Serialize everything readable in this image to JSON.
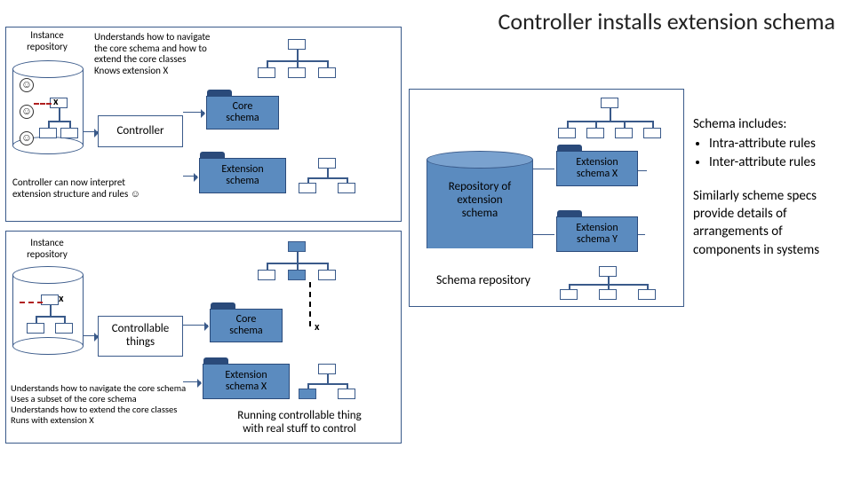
{
  "title": "Controller installs extension schema",
  "top_left": {
    "instance_repository": "Instance\nrepository",
    "desc": "Understands how to navigate\nthe core schema and how to\nextend the core classes\nKnows extension X",
    "controller": "Controller",
    "footnote": "Controller can now interpret\nextension structure and rules ☺"
  },
  "bottom_left": {
    "instance_repository": "Instance\nrepository",
    "controllable": "Controllable\nthings",
    "footnote": "Understands how to navigate the core schema\nUses a subset of the core schema\nUnderstands how to extend the core classes\nRuns with extension X"
  },
  "schemas": {
    "core1": "Core\nschema",
    "ext1": "Extension\nschema",
    "core2": "Core\nschema",
    "ext2": "Extension\nschema X"
  },
  "running": "Running controllable thing\nwith real stuff to control",
  "repo_center": {
    "label": "Repository of\nextension\nschema",
    "caption": "Schema repository"
  },
  "ext_schemas": {
    "x": "Extension\nschema X",
    "y": "Extension\nschema Y"
  },
  "right": {
    "l1": "Schema includes:",
    "b1": "Intra-attribute rules",
    "b2": "Inter-attribute rules",
    "l2": "Similarly scheme specs provide details of arrangements of components in systems"
  },
  "x": "x"
}
